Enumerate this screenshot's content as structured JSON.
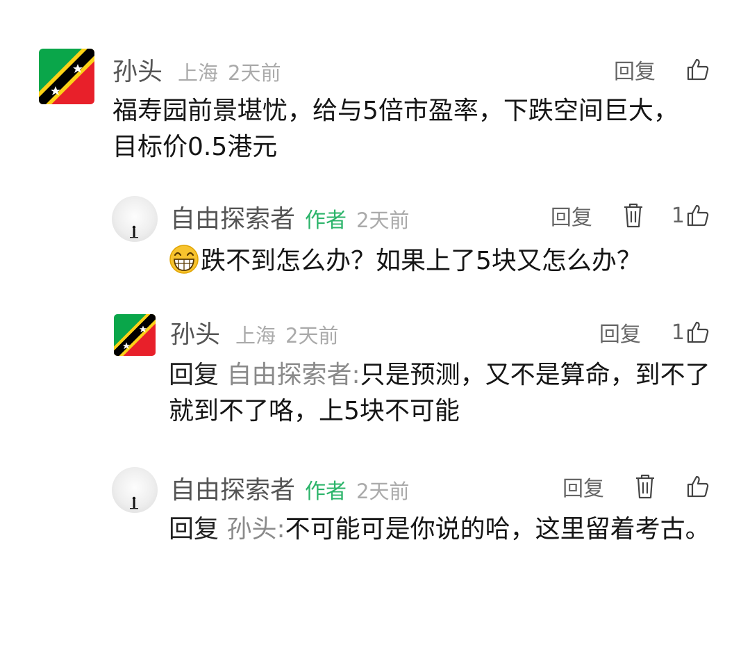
{
  "comments": [
    {
      "name": "孙头",
      "location": "上海",
      "time": "2天前",
      "reply_label": "回复",
      "text": "福寿园前景堪忧，给与5倍市盈率，下跌空间巨大，目标价0.5港元"
    },
    {
      "name": "自由探索者",
      "author_tag": "作者",
      "time": "2天前",
      "reply_label": "回复",
      "like_count": "1",
      "emoji": "grinning-face-icon",
      "text": "跌不到怎么办？如果上了5块又怎么办？"
    },
    {
      "name": "孙头",
      "location": "上海",
      "time": "2天前",
      "reply_label": "回复",
      "like_count": "1",
      "reply_prefix": "回复",
      "reply_target": "自由探索者",
      "text": "只是预测，又不是算命，到不了就到不了咯，上5块不可能"
    },
    {
      "name": "自由探索者",
      "author_tag": "作者",
      "time": "2天前",
      "reply_label": "回复",
      "reply_prefix": "回复",
      "reply_target": "孙头",
      "text": "不可能可是你说的哈，这里留着考古。"
    }
  ],
  "colors": {
    "author_tag": "#2bb46a",
    "meta": "#aaaaaa",
    "name": "#555555"
  }
}
